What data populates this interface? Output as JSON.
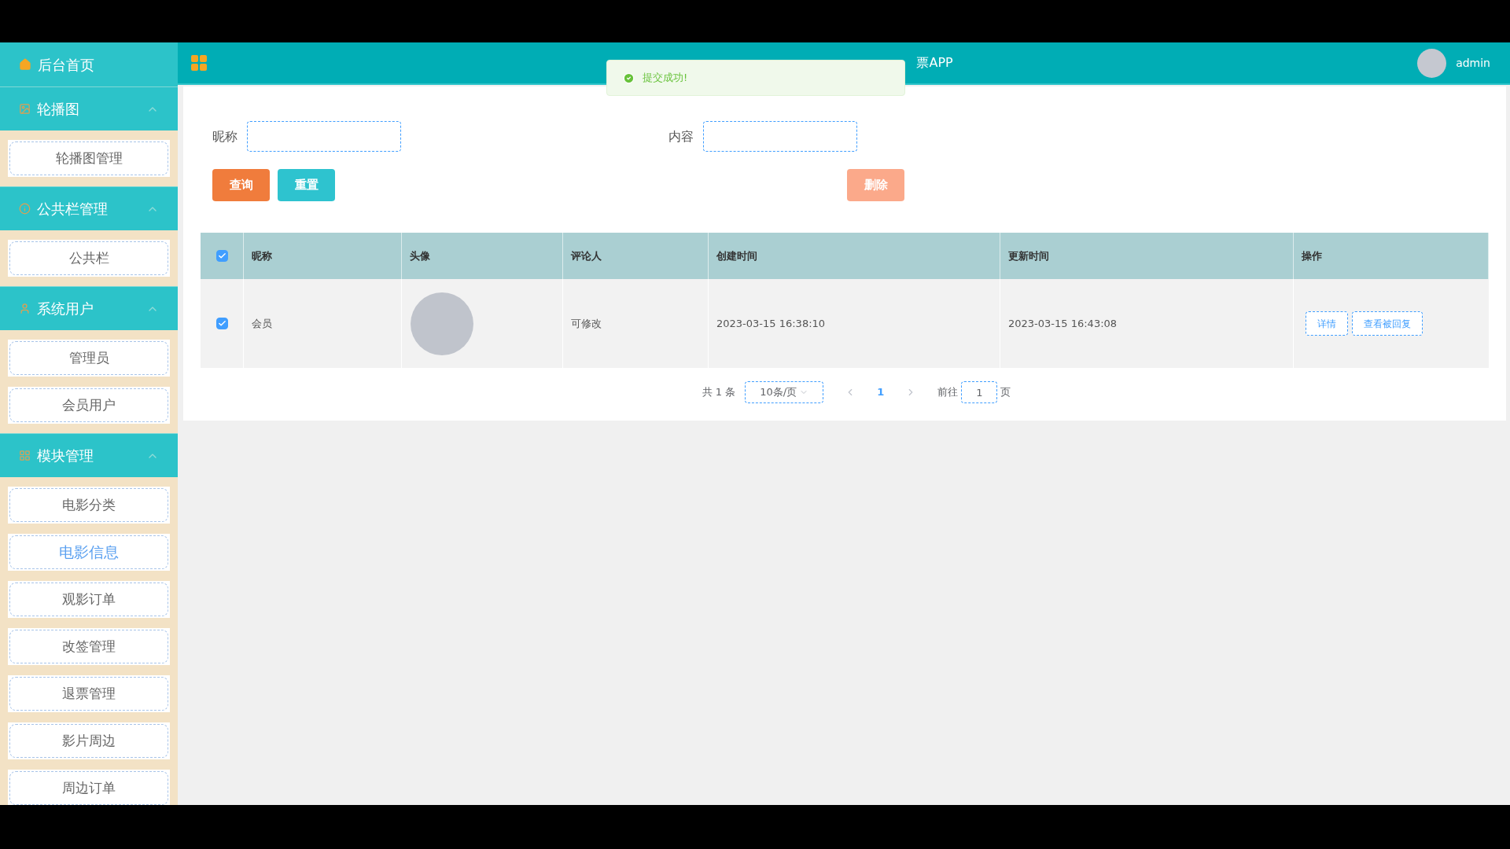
{
  "sidebar": {
    "home": {
      "label": "后台首页"
    },
    "groups": [
      {
        "title": "轮播图",
        "expanded": true,
        "items": [
          {
            "label": "轮播图管理",
            "selected": false
          }
        ]
      },
      {
        "title": "公共栏管理",
        "expanded": true,
        "items": [
          {
            "label": "公共栏",
            "selected": false
          }
        ]
      },
      {
        "title": "系统用户",
        "expanded": true,
        "items": [
          {
            "label": "管理员",
            "selected": false
          },
          {
            "label": "会员用户",
            "selected": false
          }
        ]
      },
      {
        "title": "模块管理",
        "expanded": true,
        "items": [
          {
            "label": "电影分类",
            "selected": false
          },
          {
            "label": "电影信息",
            "selected": true
          },
          {
            "label": "观影订单",
            "selected": false
          },
          {
            "label": "改签管理",
            "selected": false
          },
          {
            "label": "退票管理",
            "selected": false
          },
          {
            "label": "影片周边",
            "selected": false
          },
          {
            "label": "周边订单",
            "selected": false
          }
        ]
      }
    ]
  },
  "header": {
    "title": "票APP",
    "user": "admin"
  },
  "toast": {
    "message": "提交成功!"
  },
  "filters": [
    {
      "label": "昵称"
    },
    {
      "label": "内容"
    }
  ],
  "buttons": {
    "search": "查询",
    "reset": "重置",
    "delete": {
      "label": "删除",
      "disabled": true
    }
  },
  "table": {
    "all_checked": true,
    "columns": [
      "昵称",
      "头像",
      "评论人",
      "创建时间",
      "更新时间",
      "操作"
    ],
    "rows": [
      {
        "checked": true,
        "nickname": "会员",
        "commenter": "可修改",
        "created": "2023-03-15 16:38:10",
        "updated": "2023-03-15 16:43:08",
        "actions": [
          "详情",
          "查看被回复"
        ]
      }
    ]
  },
  "pagination": {
    "total": "共 1 条",
    "page_size": "10条/页",
    "pages": [
      {
        "label": "1",
        "selected": true
      }
    ],
    "goto_label": "前往",
    "goto_value": "1",
    "goto_suffix": "页"
  }
}
